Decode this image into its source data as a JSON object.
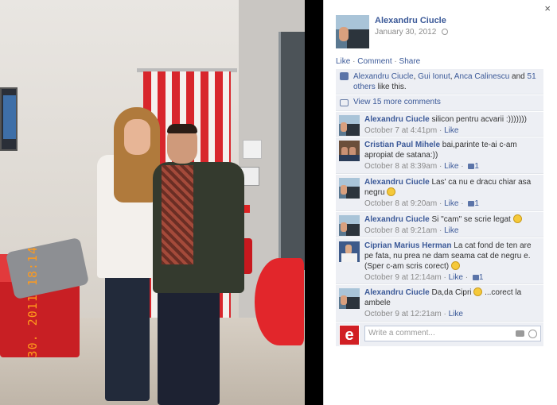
{
  "photo": {
    "timestamp_stamp": "30. 2011  18:14"
  },
  "panel": {
    "close_label": "×",
    "poster": {
      "name": "Alexandru Ciucle",
      "date": "January 30, 2012"
    },
    "actions": {
      "like": "Like",
      "comment": "Comment",
      "share": "Share",
      "separator": "·"
    },
    "likes": {
      "names": [
        "Alexandru Ciucle",
        "Gui Ionut",
        "Anca Calinescu"
      ],
      "sep1": ", ",
      "and": " and ",
      "others_link": "51 others",
      "suffix": " like this."
    },
    "view_more": "View 15 more comments",
    "comments": [
      {
        "name": "Alexandru Ciucle",
        "text": " silicon pentru acvarii :)))))))",
        "time": "October 7 at 4:41pm",
        "like": "Like",
        "like_count": ""
      },
      {
        "name": "Cristian Paul Mihele",
        "text": " bai,parinte te-ai c-am apropiat de satana:))",
        "time": "October 8 at 8:39am",
        "like": "Like",
        "like_count": "1"
      },
      {
        "name": "Alexandru Ciucle",
        "text": " Las' ca nu e dracu chiar asa negru",
        "time": "October 8 at 9:20am",
        "like": "Like",
        "like_count": "1"
      },
      {
        "name": "Alexandru Ciucle",
        "text": " Si \"cam\" se scrie legat",
        "time": "October 8 at 9:21am",
        "like": "Like",
        "like_count": ""
      },
      {
        "name": "Ciprian Marius Herman",
        "text": " La cat fond de ten are pe fata, nu prea ne dam seama cat de negru e. (Sper c-am scris corect)",
        "time": "October 9 at 12:14am",
        "like": "Like",
        "like_count": "1"
      },
      {
        "name": "Alexandru Ciucle",
        "text": " Da,da Cipri",
        "text2": " ...corect la ambele",
        "time": "October 9 at 12:21am",
        "like": "Like",
        "like_count": ""
      }
    ],
    "write_comment": {
      "avatar_letter": "e",
      "placeholder": "Write a comment..."
    }
  },
  "colors": {
    "link_blue": "#3b5998",
    "comment_bg": "#edeff4",
    "meta_gray": "#8a8a8a"
  }
}
